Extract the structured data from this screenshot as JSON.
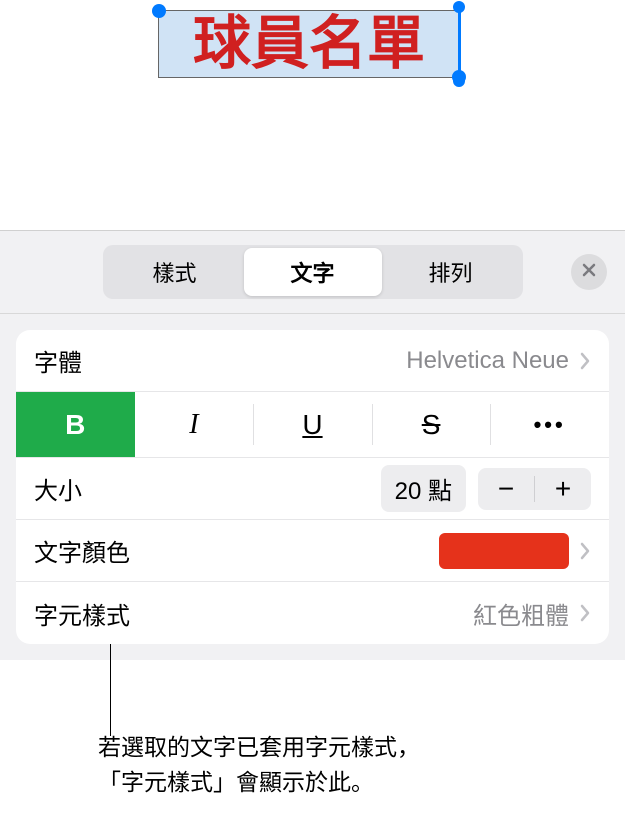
{
  "canvas": {
    "selected_text": "球員名單"
  },
  "panel": {
    "tabs": {
      "style": "樣式",
      "text": "文字",
      "arrange": "排列"
    }
  },
  "font": {
    "label": "字體",
    "value": "Helvetica Neue"
  },
  "styles": {
    "bold": "B",
    "italic": "I",
    "underline": "U",
    "strike": "S",
    "more": "•••"
  },
  "size": {
    "label": "大小",
    "value": "20 點",
    "minus": "−",
    "plus": "+"
  },
  "text_color": {
    "label": "文字顏色",
    "value_hex": "#e5321b"
  },
  "char_style": {
    "label": "字元樣式",
    "value": "紅色粗體"
  },
  "annotation": {
    "line1": "若選取的文字已套用字元樣式，",
    "line2": "「字元樣式」會顯示於此。"
  }
}
